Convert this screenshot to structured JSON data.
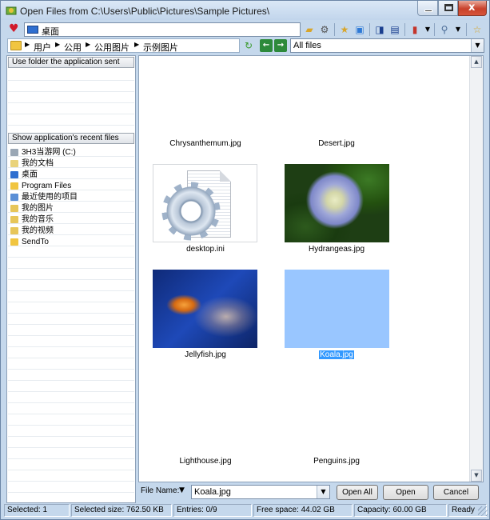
{
  "window": {
    "title": "Open Files from C:\\Users\\Public\\Pictures\\Sample Pictures\\",
    "minimize": "",
    "maximize": "",
    "close": "x"
  },
  "location": {
    "current": "桌面"
  },
  "breadcrumb": [
    "用户",
    "公用",
    "公用图片",
    "示例图片"
  ],
  "filter": {
    "value": "All files"
  },
  "left_pane": {
    "folder_header": "Use folder the application sent",
    "recent_header": "Show application's recent files",
    "recent_items": [
      {
        "label": "3H3当游网 (C:)",
        "icon": "drive-icon"
      },
      {
        "label": "我的文档",
        "icon": "documents-icon"
      },
      {
        "label": "桌面",
        "icon": "desktop-icon"
      },
      {
        "label": "Program Files",
        "icon": "folder-icon"
      },
      {
        "label": "最近使用的项目",
        "icon": "recent-icon"
      },
      {
        "label": "我的图片",
        "icon": "pictures-icon"
      },
      {
        "label": "我的音乐",
        "icon": "music-icon"
      },
      {
        "label": "我的视频",
        "icon": "videos-icon"
      },
      {
        "label": "SendTo",
        "icon": "folder-icon"
      }
    ]
  },
  "files": [
    {
      "name": "Chrysanthemum.jpg",
      "selected": false
    },
    {
      "name": "Desert.jpg",
      "selected": false
    },
    {
      "name": "desktop.ini",
      "selected": false
    },
    {
      "name": "Hydrangeas.jpg",
      "selected": false
    },
    {
      "name": "Jellyfish.jpg",
      "selected": false
    },
    {
      "name": "Koala.jpg",
      "selected": true
    },
    {
      "name": "Lighthouse.jpg",
      "selected": false
    },
    {
      "name": "Penguins.jpg",
      "selected": false
    }
  ],
  "bottom": {
    "file_name_label": "File Name:",
    "file_name_value": "Koala.jpg",
    "open_all": "Open All",
    "open": "Open",
    "cancel": "Cancel"
  },
  "status": {
    "selected": "Selected: 1",
    "selected_size": "Selected size: 762.50 KB",
    "entries": "Entries: 0/9",
    "free_space": "Free space: 44.02 GB",
    "capacity": "Capacity: 60.00 GB",
    "state": "Ready"
  },
  "colors": {
    "selection": "#3399ff",
    "window_frame": "#c5d8ec"
  }
}
